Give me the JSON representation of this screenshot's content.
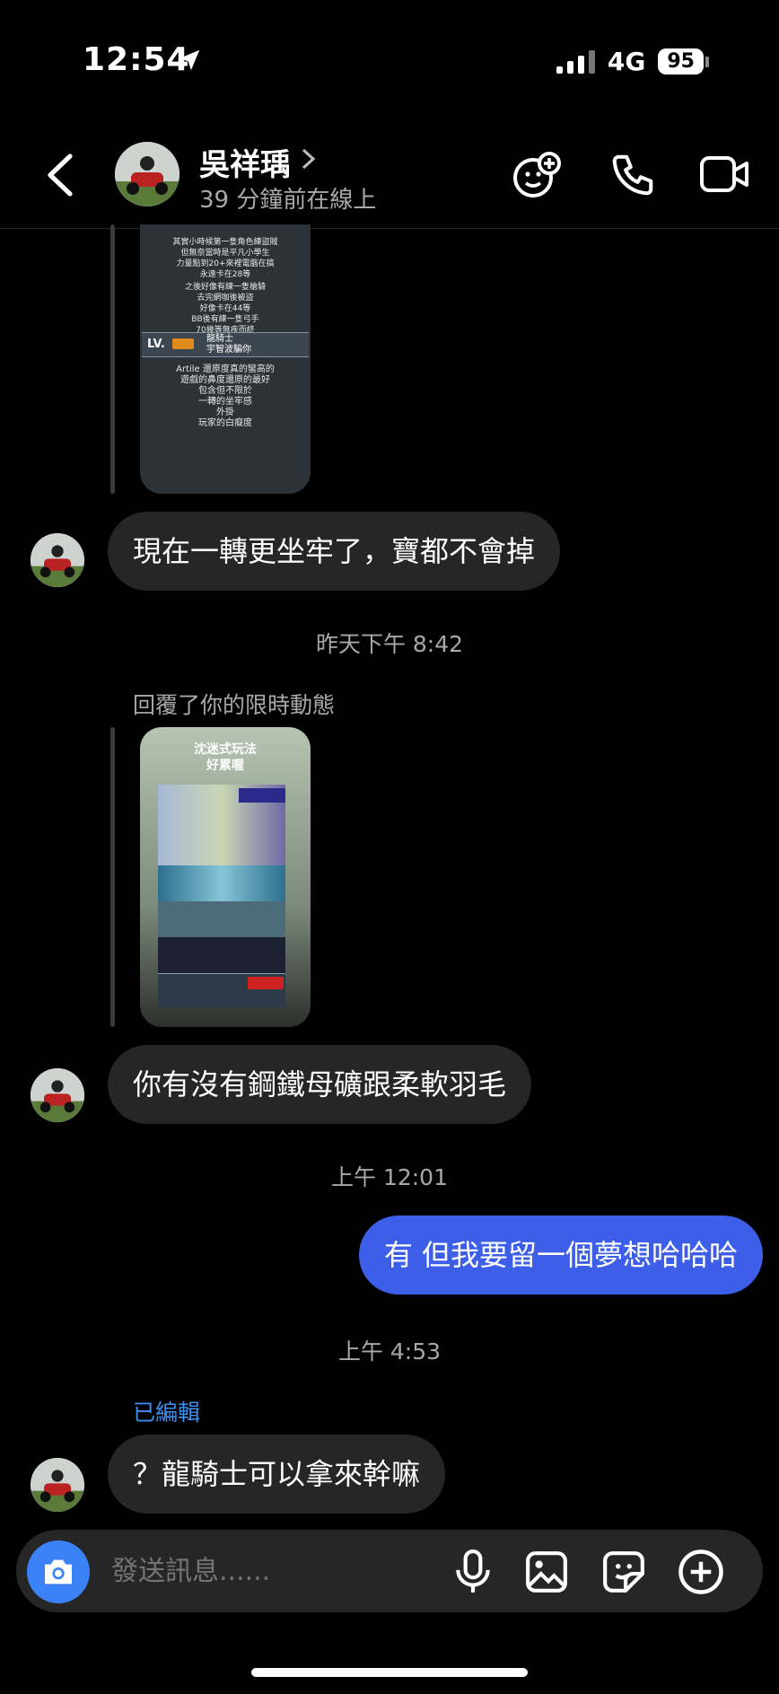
{
  "status_bar": {
    "time": "12:54",
    "network": "4G",
    "battery": "95"
  },
  "header": {
    "name": "吳祥瑀",
    "status": "39 分鐘前在線上"
  },
  "story1": {
    "caption_top": [
      "其實小時候第一隻角色練盜賊",
      "但無奈當時是平凡小學生",
      "力量點到20+來裡電腦在搞",
      "永遠卡在28等",
      "",
      "之後好像有練一隻槍騎",
      "去完網咖後被盜",
      "好像卡在44等",
      "BB後有練一隻弓手",
      "70幾等無疾而終"
    ],
    "level_label": "LV.",
    "char_lines": [
      "龍騎士",
      "宇智波騙你"
    ],
    "caption_bottom": [
      "Artile 還原度真的蠻高的",
      "遊戲的鼻度還原的最好",
      "包含但不限於",
      "一轉的坐牢感",
      "外掛",
      "玩家的白癡度"
    ]
  },
  "messages": {
    "m1": "現在一轉更坐牢了，寶都不會掉",
    "ts1": "昨天下午 8:42",
    "reply_label": "回覆了你的限時動態",
    "story2_caption": [
      "沈迷式玩法",
      "好累喔"
    ],
    "m2": "你有沒有鋼鐵母礦跟柔軟羽毛",
    "ts2": "上午 12:01",
    "m3": "有 但我要留一個夢想哈哈哈",
    "ts3": "上午 4:53",
    "edited": "已編輯",
    "m4": "？龍騎士可以拿來幹嘛"
  },
  "composer": {
    "placeholder": "發送訊息......"
  },
  "icons": [
    "location-arrow-icon",
    "back-chevron-icon",
    "add-emoji-icon",
    "phone-icon",
    "video-icon",
    "camera-icon",
    "microphone-icon",
    "gallery-icon",
    "sticker-icon",
    "plus-icon"
  ]
}
